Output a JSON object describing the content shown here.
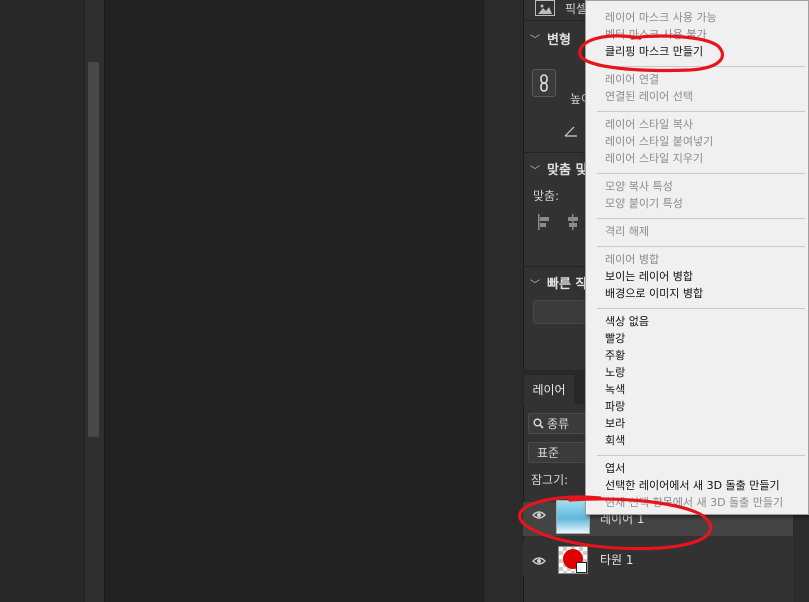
{
  "properties": {
    "pixel_label": "픽셀",
    "transform_title": "변형",
    "height_label": "높이",
    "align_title": "맞춤 및",
    "align_label": "맞춤:",
    "quick_title": "빠른 작"
  },
  "layers_panel": {
    "tab_label": "레이어",
    "filter_label": "종류",
    "blend_mode": "표준",
    "lock_label": "잠그기:",
    "layers": [
      {
        "name": "레이어 1"
      },
      {
        "name": "타원 1"
      }
    ]
  },
  "context_menu": {
    "items": [
      {
        "label": "레이어 마스크 사용 가능",
        "enabled": false
      },
      {
        "label": "벡터 마스크 사용 불가",
        "enabled": false
      },
      {
        "label": "클리핑 마스크 만들기",
        "enabled": true
      },
      {
        "label": "레이어 연결",
        "enabled": false
      },
      {
        "label": "연결된 레이어 선택",
        "enabled": false
      },
      {
        "label": "레이어 스타일 복사",
        "enabled": false
      },
      {
        "label": "레이어 스타일 붙여넣기",
        "enabled": false
      },
      {
        "label": "레이어 스타일 지우기",
        "enabled": false
      },
      {
        "label": "모양 복사 특성",
        "enabled": false
      },
      {
        "label": "모양 붙이기 특성",
        "enabled": false
      },
      {
        "label": "격리 해제",
        "enabled": false
      },
      {
        "label": "레이어 병합",
        "enabled": false
      },
      {
        "label": "보이는 레이어 병합",
        "enabled": true
      },
      {
        "label": "배경으로 이미지 병합",
        "enabled": true
      },
      {
        "label": "색상 없음",
        "enabled": true
      },
      {
        "label": "빨강",
        "enabled": true
      },
      {
        "label": "주황",
        "enabled": true
      },
      {
        "label": "노랑",
        "enabled": true
      },
      {
        "label": "녹색",
        "enabled": true
      },
      {
        "label": "파랑",
        "enabled": true
      },
      {
        "label": "보라",
        "enabled": true
      },
      {
        "label": "회색",
        "enabled": true
      },
      {
        "label": "엽서",
        "enabled": true
      },
      {
        "label": "선택한 레이어에서 새 3D 돌출 만들기",
        "enabled": true
      },
      {
        "label": "현재 선택 항목에서 새 3D 돌출 만들기",
        "enabled": false
      }
    ]
  },
  "colors": {
    "annotation": "#e8141b",
    "menu_bg": "#f0f0f0",
    "panel_bg": "#323232"
  }
}
